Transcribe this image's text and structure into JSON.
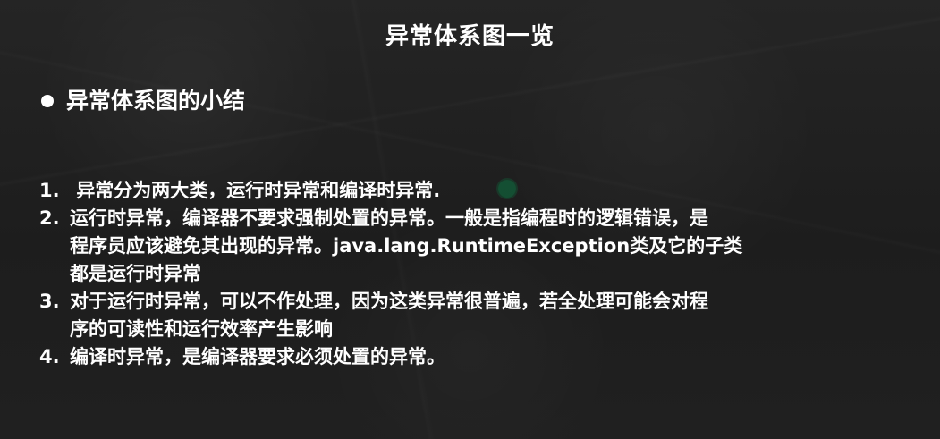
{
  "title": "异常体系图一览",
  "section_heading": "异常体系图的小结",
  "list_items": [
    {
      "number": "1.",
      "text": " 异常分为两大类，运行时异常和编译时异常."
    },
    {
      "number": "2.",
      "text": "运行时异常，编译器不要求强制处置的异常。一般是指编程时的逻辑错误，是\n程序员应该避免其出现的异常。java.lang.RuntimeException类及它的子类\n都是运行时异常"
    },
    {
      "number": "3.",
      "text": "对于运行时异常，可以不作处理，因为这类异常很普遍，若全处理可能会对程\n序的可读性和运行效率产生影响"
    },
    {
      "number": "4.",
      "text": "编译时异常，是编译器要求必须处置的异常。"
    }
  ],
  "colors": {
    "background": "#1f1f1f",
    "text": "#ffffff",
    "cursor_highlight": "#00aa5a"
  }
}
